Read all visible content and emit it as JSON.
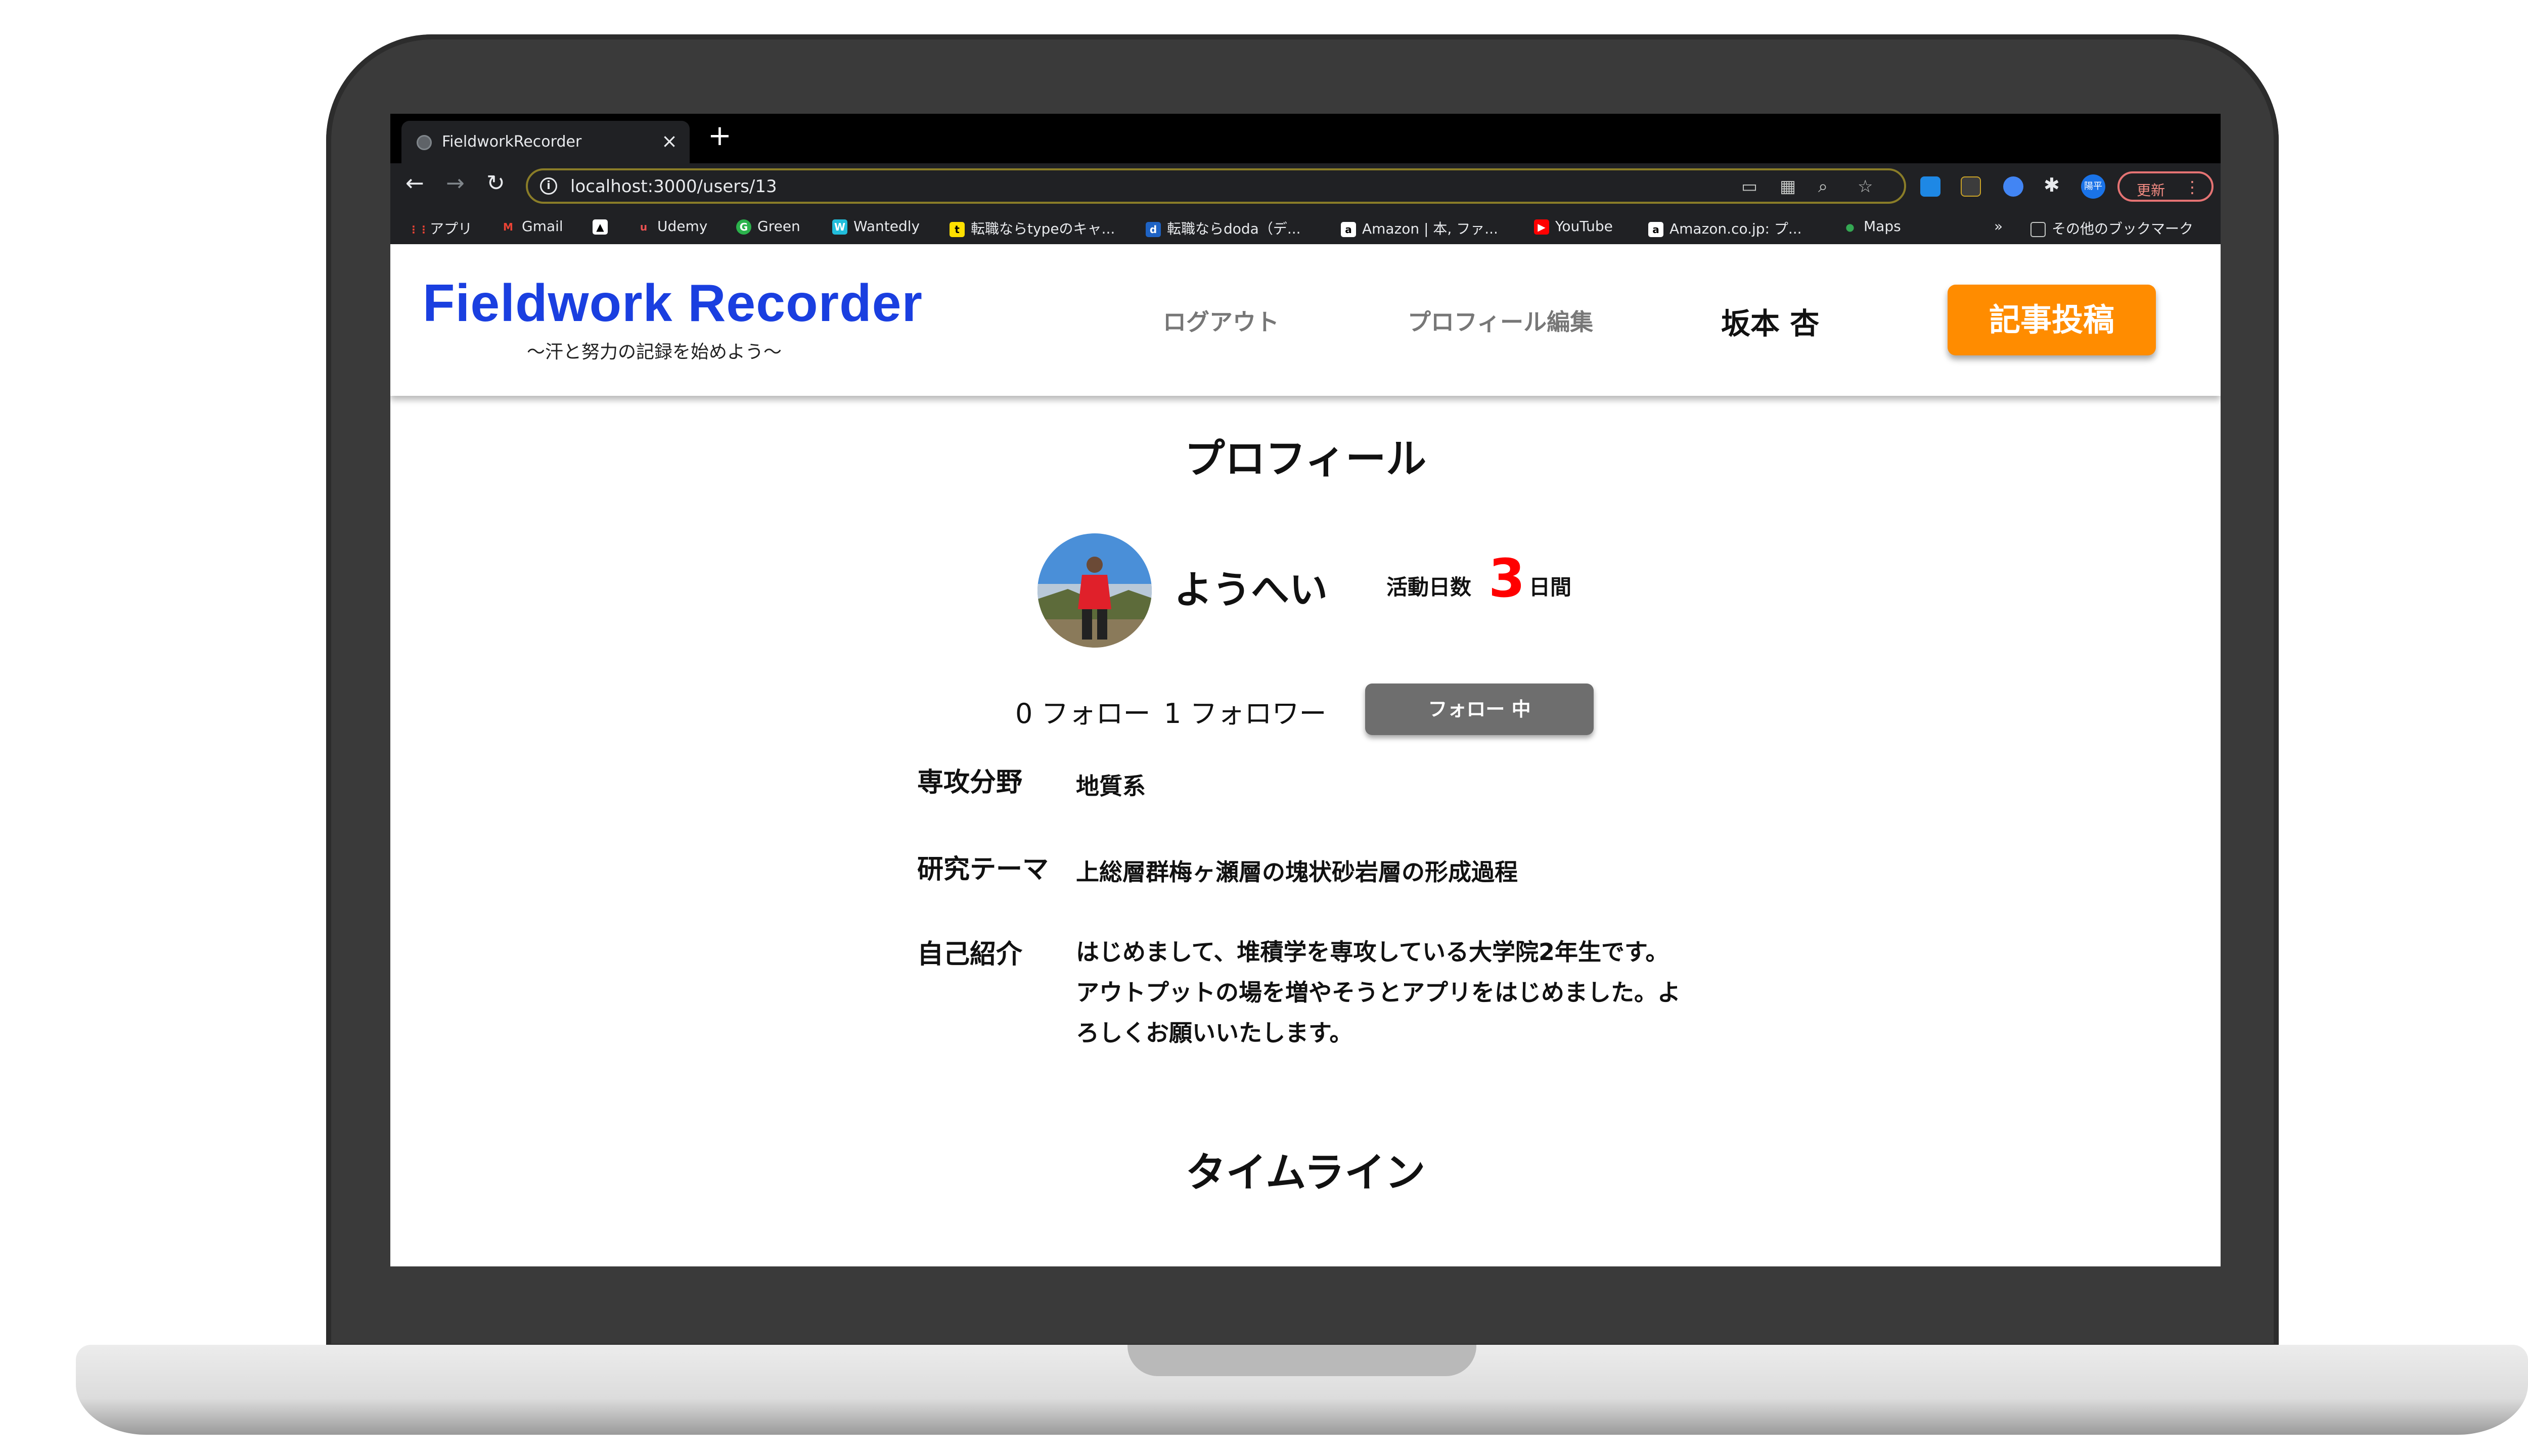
{
  "browser": {
    "tab_title": "FieldworkRecorder",
    "tab_close": "×",
    "new_tab": "+",
    "url": "localhost:3000/users/13",
    "avatar_label": "陽平",
    "update_label": "更新",
    "more": "⋮"
  },
  "bookmarks": [
    {
      "label": "アプリ",
      "icon": "apps-grid-icon"
    },
    {
      "label": "Gmail",
      "icon": "gmail-icon"
    },
    {
      "label": "",
      "icon": "triangle-icon"
    },
    {
      "label": "Udemy",
      "icon": "udemy-icon"
    },
    {
      "label": "Green",
      "icon": "green-icon"
    },
    {
      "label": "Wantedly",
      "icon": "wantedly-icon"
    },
    {
      "label": "転職ならtypeのキャ...",
      "icon": "type-icon"
    },
    {
      "label": "転職ならdoda（デ...",
      "icon": "doda-icon"
    },
    {
      "label": "Amazon | 本, ファ...",
      "icon": "amazon-icon"
    },
    {
      "label": "YouTube",
      "icon": "youtube-icon"
    },
    {
      "label": "Amazon.co.jp: プ...",
      "icon": "amazon-icon"
    },
    {
      "label": "Maps",
      "icon": "maps-icon"
    }
  ],
  "bookmarks_overflow": "»",
  "other_bookmarks": "その他のブックマーク",
  "header": {
    "logo": "Fieldwork Recorder",
    "tagline": "〜汗と努力の記録を始めよう〜",
    "logout": "ログアウト",
    "edit_profile": "プロフィール編集",
    "user_name": "坂本 杏",
    "post_button": "記事投稿"
  },
  "profile": {
    "title": "プロフィール",
    "name": "ようへい",
    "activity_label": "活動日数",
    "activity_days": "3",
    "activity_unit": "日間",
    "following": "0 フォロー",
    "followers": "1 フォロワー",
    "follow_button": "フォロー 中",
    "fields": [
      {
        "label": "専攻分野",
        "value": "地質系"
      },
      {
        "label": "研究テーマ",
        "value": "上総層群梅ヶ瀬層の塊状砂岩層の形成過程"
      },
      {
        "label": "自己紹介",
        "value": "はじめまして、堆積学を専攻している大学院2年生です。アウトプットの場を増やそうとアプリをはじめました。よろしくお願いいたします。"
      }
    ]
  },
  "timeline": {
    "title": "タイムライン"
  }
}
